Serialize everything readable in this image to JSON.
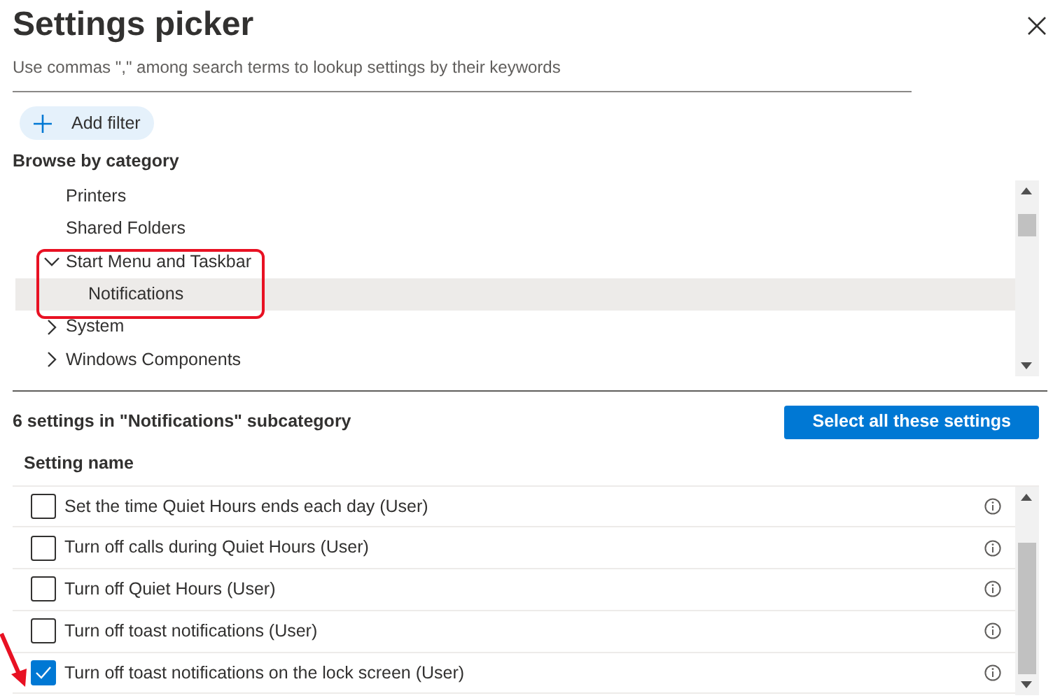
{
  "title": "Settings picker",
  "subtitle": "Use commas \",\" among search terms to lookup settings by their keywords",
  "add_filter": {
    "label": "Add filter"
  },
  "browse": {
    "heading": "Browse by category",
    "tree": [
      {
        "label": "Printers",
        "kind": "leaf",
        "selected": false
      },
      {
        "label": "Shared Folders",
        "kind": "leaf",
        "selected": false
      },
      {
        "label": "Start Menu and Taskbar",
        "kind": "group",
        "expanded": true,
        "selected": false,
        "children": [
          {
            "label": "Notifications",
            "kind": "leaf",
            "selected": true
          }
        ]
      },
      {
        "label": "System",
        "kind": "group",
        "expanded": false,
        "selected": false
      },
      {
        "label": "Windows Components",
        "kind": "group",
        "expanded": false,
        "selected": false
      }
    ]
  },
  "settings": {
    "summary": "6 settings in \"Notifications\" subcategory",
    "select_all": "Select all these settings",
    "column": "Setting name",
    "rows": [
      {
        "name": "Set the time Quiet Hours ends each day (User)",
        "checked": false
      },
      {
        "name": "Turn off calls during Quiet Hours (User)",
        "checked": false
      },
      {
        "name": "Turn off Quiet Hours (User)",
        "checked": false
      },
      {
        "name": "Turn off toast notifications (User)",
        "checked": false
      },
      {
        "name": "Turn off toast notifications on the lock screen (User)",
        "checked": true
      }
    ]
  }
}
